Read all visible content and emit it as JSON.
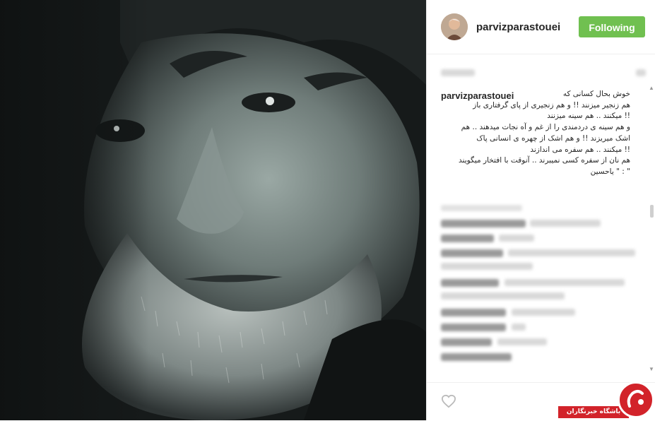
{
  "header": {
    "username": "parvizparastouei",
    "follow_label": "Following",
    "follow_color": "#70c050"
  },
  "post": {
    "caption_user": "parvizparastouei",
    "caption_lines": [
      "خوش بحال کسانی که",
      "هم زنجیر میزنند !! و هم زنجیری از پای گرفتاری باز",
      "!! میکنند .. هم سینه میزنند",
      "و هم سینه ی دردمندی را از غم و آه نجات میدهند .. هم",
      "اشک میریزند !! و هم اشک از چهره ی انسانی پاک",
      "!! میکنند .. هم سفره می اندازند",
      "هم نان از سفره کسی نمیبرند .. آنوقت با افتخار میگویند",
      "\" : \" یاحسین"
    ]
  },
  "icons": {
    "heart": "heart-icon",
    "scroll_up": "scroll-up-arrow-icon",
    "scroll_down": "scroll-down-arrow-icon"
  },
  "watermark": {
    "text": "باشگاه خبرنگاران",
    "color": "#d2232a"
  }
}
